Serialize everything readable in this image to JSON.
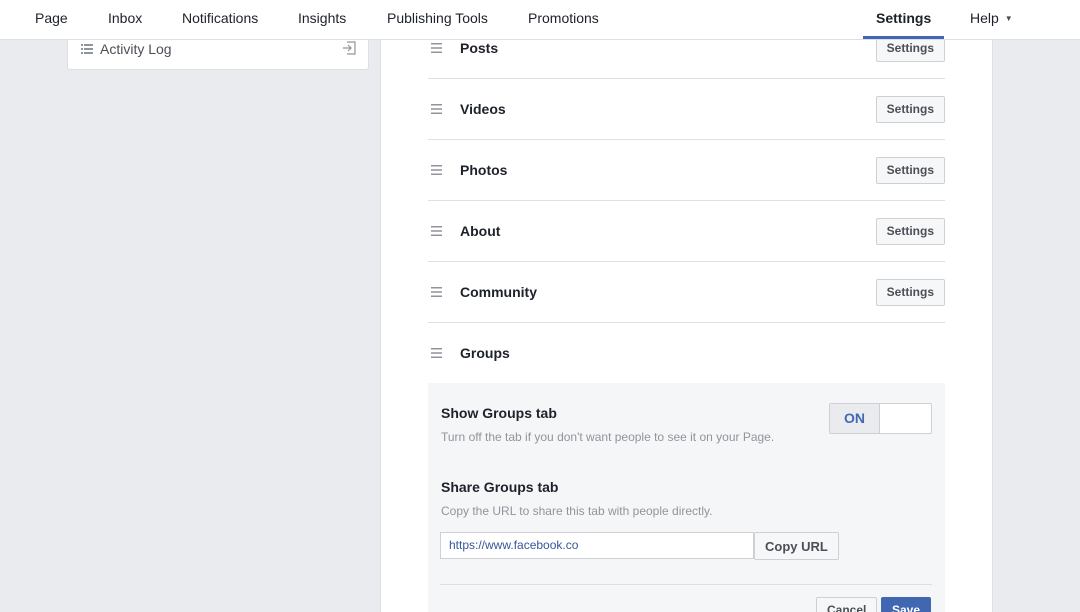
{
  "nav": {
    "items": [
      {
        "label": "Page"
      },
      {
        "label": "Inbox"
      },
      {
        "label": "Notifications"
      },
      {
        "label": "Insights"
      },
      {
        "label": "Publishing Tools"
      },
      {
        "label": "Promotions"
      }
    ],
    "settings_label": "Settings",
    "help_label": "Help",
    "help_caret": "▼"
  },
  "sidebar": {
    "activity_log_label": "Activity Log"
  },
  "tabs": {
    "settings_button_label": "Settings",
    "rows": [
      {
        "title": "Posts"
      },
      {
        "title": "Videos"
      },
      {
        "title": "Photos"
      },
      {
        "title": "About"
      },
      {
        "title": "Community"
      },
      {
        "title": "Groups"
      }
    ]
  },
  "groups": {
    "show_heading": "Show Groups tab",
    "show_desc": "Turn off the tab if you don't want people to see it on your Page.",
    "toggle_label": "ON",
    "toggle_state": "on",
    "share_heading": "Share Groups tab",
    "share_desc": "Copy the URL to share this tab with people directly.",
    "url_value": "https://www.facebook.co",
    "copy_url_label": "Copy URL",
    "cancel_label": "Cancel",
    "save_label": "Save"
  },
  "colors": {
    "accent": "#4267b2",
    "page_bg": "#e9ebee"
  }
}
